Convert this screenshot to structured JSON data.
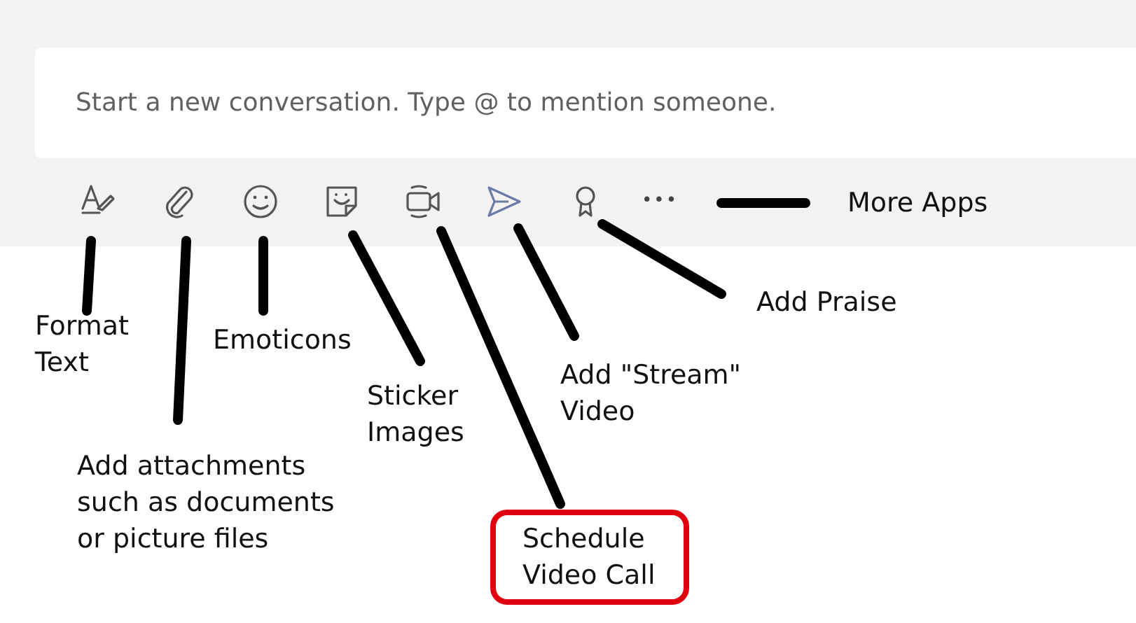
{
  "compose": {
    "placeholder": "Start a new conversation. Type @ to mention someone."
  },
  "toolbar": {
    "more": "•••"
  },
  "annotations": [
    {
      "text": "More Apps",
      "highlighted": false
    },
    {
      "text": "Add Praise",
      "highlighted": false
    },
    {
      "text": "Format\nText",
      "highlighted": false
    },
    {
      "text": "Emoticons",
      "highlighted": false
    },
    {
      "text": "Add \"Stream\"\nVideo",
      "highlighted": false
    },
    {
      "text": "Sticker\nImages",
      "highlighted": false
    },
    {
      "text": "Add attachments\nsuch as documents\nor picture files",
      "highlighted": false
    },
    {
      "text": "Schedule\nVideo Call",
      "highlighted": true
    }
  ]
}
